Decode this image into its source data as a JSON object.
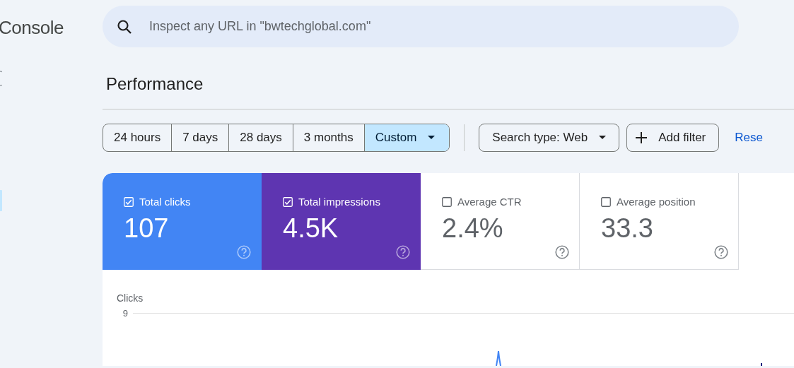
{
  "brand": {
    "text": "Console"
  },
  "search": {
    "placeholder": "Inspect any URL in \"bwtechglobal.com\""
  },
  "page_title": "Performance",
  "date_ranges": [
    {
      "label": "24 hours",
      "selected": false,
      "kind": "option"
    },
    {
      "label": "7 days",
      "selected": false,
      "kind": "option"
    },
    {
      "label": "28 days",
      "selected": false,
      "kind": "option"
    },
    {
      "label": "3 months",
      "selected": false,
      "kind": "option"
    },
    {
      "label": "Custom",
      "selected": true,
      "kind": "dropdown"
    }
  ],
  "filters": [
    {
      "label": "Search type: Web",
      "kind": "dropdown"
    },
    {
      "label": "Add filter",
      "kind": "add"
    }
  ],
  "reset_link": "Rese",
  "metrics": [
    {
      "label": "Total clicks",
      "value": "107",
      "checked": true,
      "color": "#4285f4"
    },
    {
      "label": "Total impressions",
      "value": "4.5K",
      "checked": true,
      "color": "#5e35b1"
    },
    {
      "label": "Average CTR",
      "value": "2.4%",
      "checked": false
    },
    {
      "label": "Average position",
      "value": "33.3",
      "checked": false
    }
  ],
  "chart": {
    "ylabel": "Clicks",
    "ytick": "9"
  }
}
